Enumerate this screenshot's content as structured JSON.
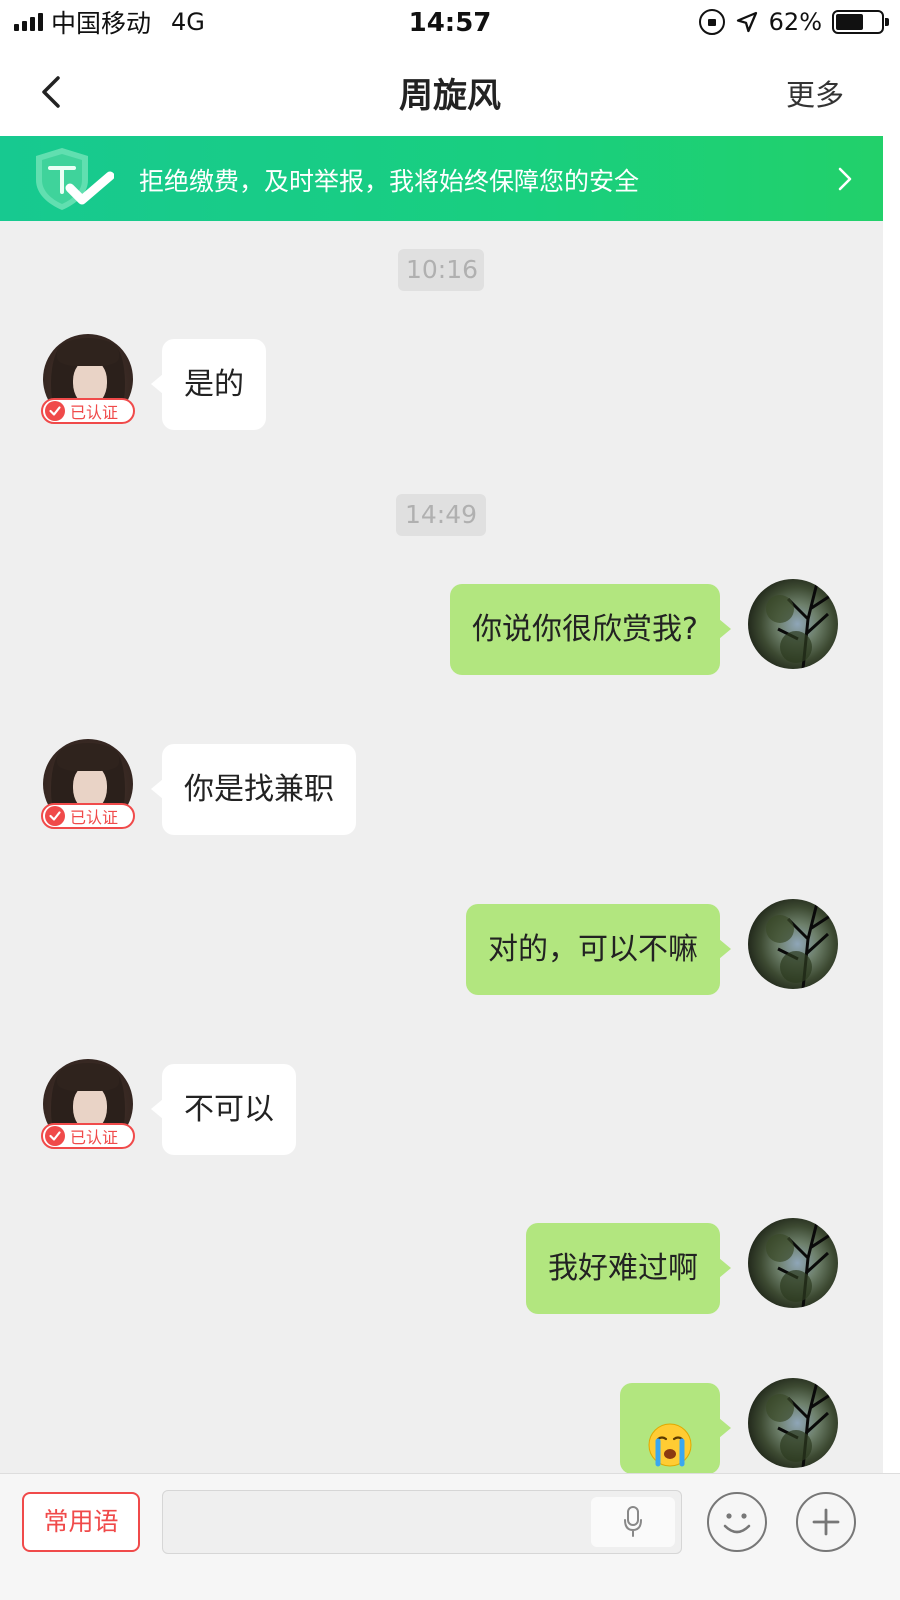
{
  "status_bar": {
    "carrier": "中国移动",
    "network": "4G",
    "time": "14:57",
    "battery_percent": "62%",
    "battery_level": 0.62,
    "icons": [
      "signal-icon",
      "rotation-lock-icon",
      "location-icon",
      "battery-icon"
    ]
  },
  "nav": {
    "title": "周旋风",
    "more": "更多",
    "back_icon": "chevron-left-icon"
  },
  "banner": {
    "text": "拒绝缴费，及时举报，我将始终保障您的安全",
    "icon": "shield-check-icon",
    "accent": "#19cf7f"
  },
  "chat": {
    "timestamps": [
      "10:16",
      "14:49"
    ],
    "verified_label": "已认证",
    "messages": [
      {
        "from": "other",
        "text": "是的"
      },
      {
        "from": "me",
        "text": "你说你很欣赏我?"
      },
      {
        "from": "other",
        "text": "你是找兼职"
      },
      {
        "from": "me",
        "text": "对的，可以不嘛"
      },
      {
        "from": "other",
        "text": "不可以"
      },
      {
        "from": "me",
        "text": "我好难过啊"
      },
      {
        "from": "me",
        "text": "😭"
      }
    ],
    "colors": {
      "incoming": "#ffffff",
      "outgoing": "#b2e67f",
      "verified": "#f04a4a",
      "background": "#efefef"
    }
  },
  "input_bar": {
    "phrases_label": "常用语",
    "icons": [
      "microphone-icon",
      "emoji-icon",
      "plus-icon"
    ]
  }
}
